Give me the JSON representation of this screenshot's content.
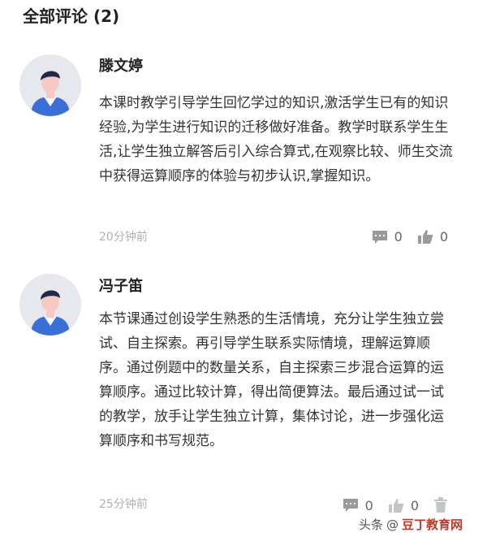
{
  "section": {
    "title": "全部评论 (2)"
  },
  "comments": [
    {
      "username": "滕文婷",
      "content": "本课时教学引导学生回忆学过的知识,激活学生已有的知识经验,为学生进行知识的迁移做好准备。教学时联系学生生活,让学生独立解答后引入综合算式,在观察比较、师生交流中获得运算顺序的体验与初步认识,掌握知识。",
      "time": "20分钟前",
      "comment_count": "0",
      "like_count": "0"
    },
    {
      "username": "冯子笛",
      "content": "本节课通过创设学生熟悉的生活情境，充分让学生独立尝试、自主探索。再引导学生联系实际情境，理解运算顺序。通过例题中的数量关系，自主探索三步混合运算的运算顺序。通过比较计算，得出简便算法。最后通过试一试的教学，放手让学生独立计算，集体讨论，进一步强化运算顺序和书写规范。",
      "time": "25分钟前",
      "comment_count": "0",
      "like_count": "0"
    }
  ],
  "watermark": {
    "prefix": "头条",
    "text": "@",
    "site": "豆丁教育网"
  },
  "icons": {
    "comment": "comment-bubble-icon",
    "like": "thumbs-up-icon",
    "delete": "trash-icon",
    "avatar": "default-user-avatar-icon"
  },
  "colors": {
    "icon_gray": "#9a9a9a",
    "time_gray": "#b0b0b0",
    "avatar_bg": "#e6e8ee",
    "avatar_shirt": "#3b6fd8",
    "avatar_hair": "#1e2a4a"
  }
}
